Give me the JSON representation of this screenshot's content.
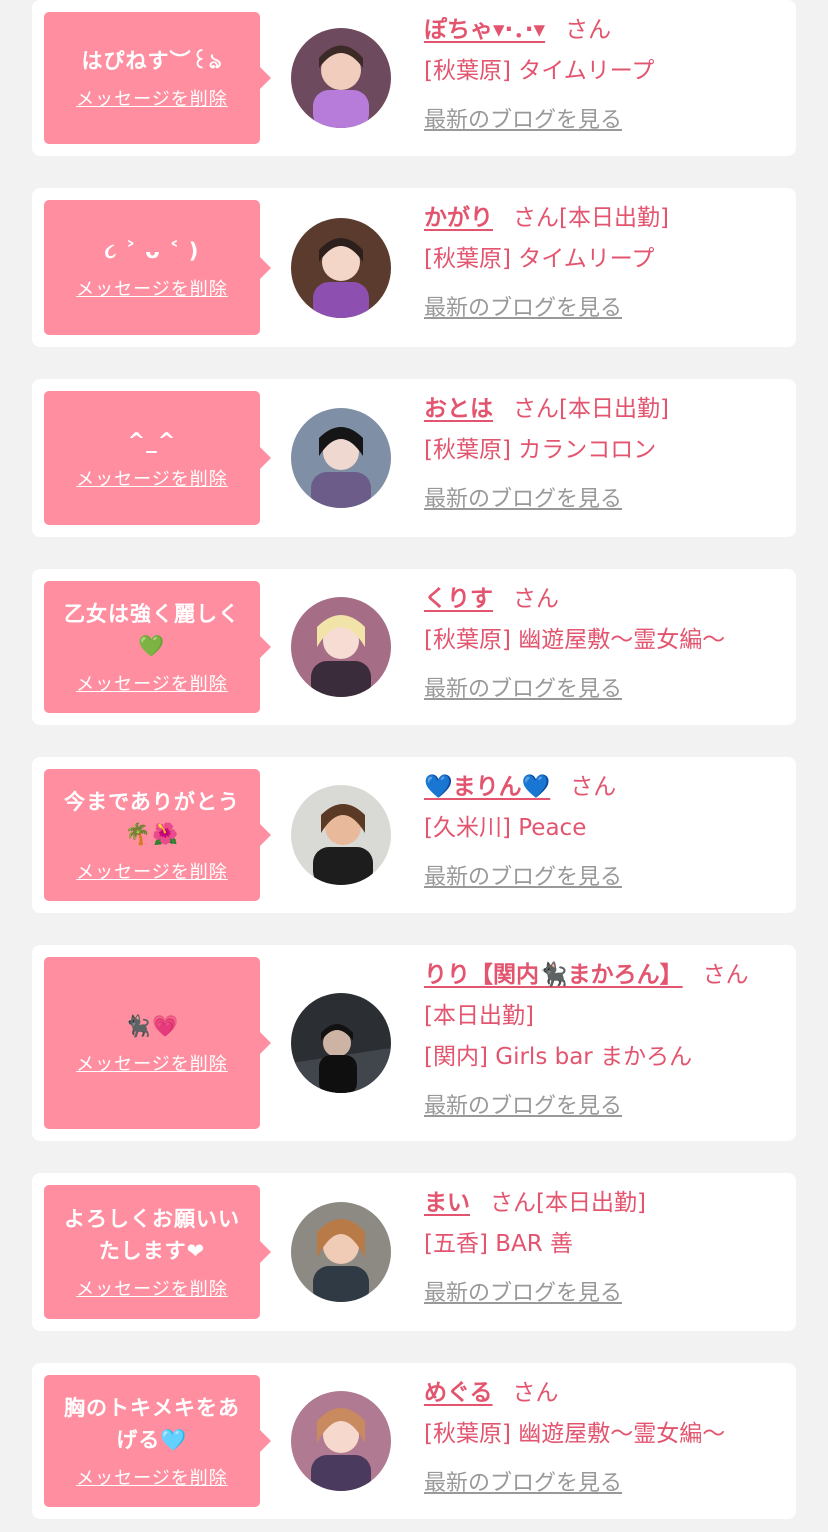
{
  "delete_label": "メッセージを削除",
  "blog_label": "最新のブログを見る",
  "san_label": "さん",
  "colors": {
    "accent": "#e3556f",
    "bubble": "#ff8fa0",
    "link_gray": "#999999"
  },
  "cards": [
    {
      "message": "はぴねす︶꒰ঌ",
      "name": "ぽちゃ▾·．·▾",
      "status": "",
      "area": "[秋葉原] タイムリープ"
    },
    {
      "message": "૮ ˃ ᴗ ˂ )",
      "name": "かがり",
      "status": "[本日出勤]",
      "area": "[秋葉原] タイムリープ"
    },
    {
      "message": "^_^",
      "name": "おとは",
      "status": "[本日出勤]",
      "area": "[秋葉原] カランコロン"
    },
    {
      "message": "乙女は強く麗しく💚",
      "name": "くりす",
      "status": "",
      "area": "[秋葉原] 幽遊屋敷〜霊女編〜"
    },
    {
      "message": "今までありがとう🌴🌺",
      "name": "💙まりん💙",
      "status": "",
      "area": "[久米川] Peace"
    },
    {
      "message": "🐈‍⬛💗",
      "name": "りり【関内🐈‍⬛まかろん】",
      "status": "[本日出勤]",
      "area": "[関内] Girls bar まかろん"
    },
    {
      "message": "よろしくお願いいたします❤",
      "name": "まい",
      "status": "[本日出勤]",
      "area": "[五香] BAR 善"
    },
    {
      "message": "胸のトキメキをあげる🩵",
      "name": "めぐる",
      "status": "",
      "area": "[秋葉原] 幽遊屋敷〜霊女編〜"
    }
  ]
}
